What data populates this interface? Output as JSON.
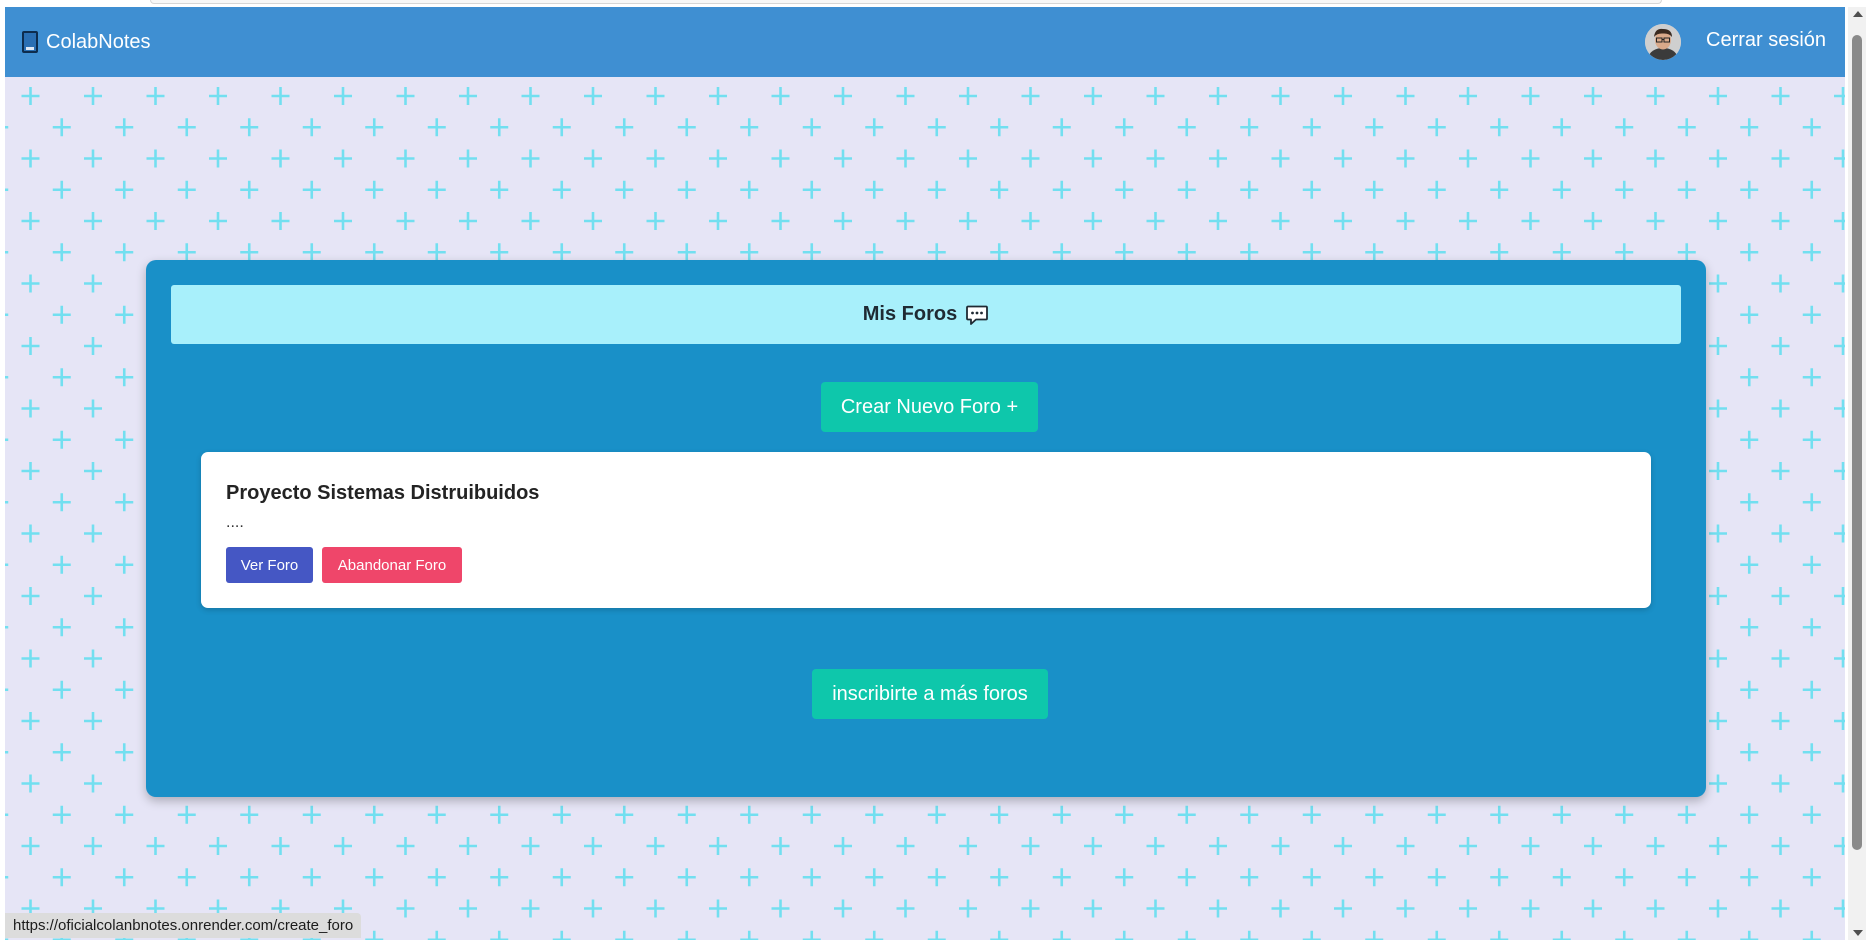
{
  "app": {
    "brand_name": "ColabNotes",
    "brand_icon": "book-icon",
    "logout_label": "Cerrar sesión"
  },
  "panel": {
    "title": "Mis Foros",
    "title_icon": "speech-bubble-icon",
    "create_button_label": "Crear Nuevo Foro +",
    "subscribe_button_label": "inscribirte a más foros"
  },
  "forums": [
    {
      "name": "Proyecto Sistemas Distruibuidos",
      "description": "....",
      "view_label": "Ver Foro",
      "leave_label": "Abandonar Foro"
    }
  ],
  "status_bar": {
    "url": "https://oficialcolanbnotes.onrender.com/create_foro"
  },
  "colors": {
    "navbar": "#3f8fd2",
    "background": "#e6e5f6",
    "pattern": "#6fe0ef",
    "panel": "#1990c8",
    "panel_header": "#a8f0fb",
    "teal_button": "#0ec7ab",
    "view_button": "#4557c4",
    "leave_button": "#ef466a"
  }
}
